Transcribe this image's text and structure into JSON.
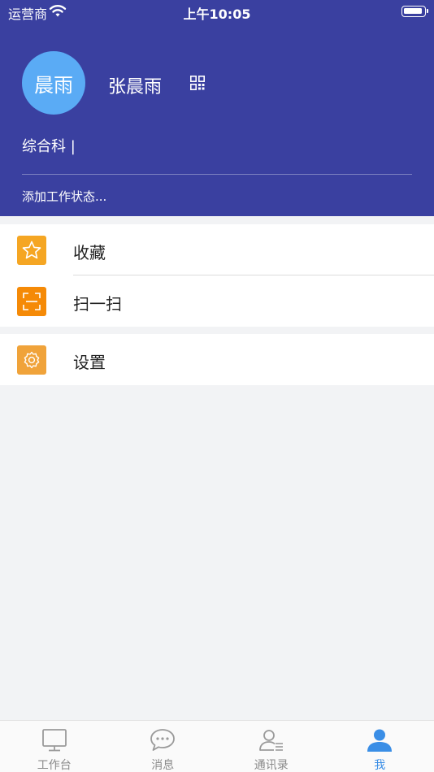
{
  "status_bar": {
    "carrier": "运营商",
    "time": "上午10:05"
  },
  "profile": {
    "avatar_text": "晨雨",
    "name": "张晨雨",
    "department": "综合科 |",
    "work_status": "添加工作状态..."
  },
  "menu": {
    "group1": [
      {
        "label": "收藏",
        "icon": "star-icon",
        "color": "#f5a623"
      },
      {
        "label": "扫一扫",
        "icon": "scan-icon",
        "color": "#f58a07"
      }
    ],
    "group2": [
      {
        "label": "设置",
        "icon": "gear-icon",
        "color": "#f0a33a"
      }
    ]
  },
  "tabbar": {
    "tabs": [
      {
        "label": "工作台",
        "icon": "monitor-icon"
      },
      {
        "label": "消息",
        "icon": "chat-bubble-icon"
      },
      {
        "label": "通讯录",
        "icon": "contacts-icon"
      },
      {
        "label": "我",
        "icon": "user-icon",
        "active": true
      }
    ]
  },
  "colors": {
    "header_bg": "#3a40a0",
    "avatar_bg": "#5aabf5",
    "active_tab": "#3a8ee6"
  }
}
